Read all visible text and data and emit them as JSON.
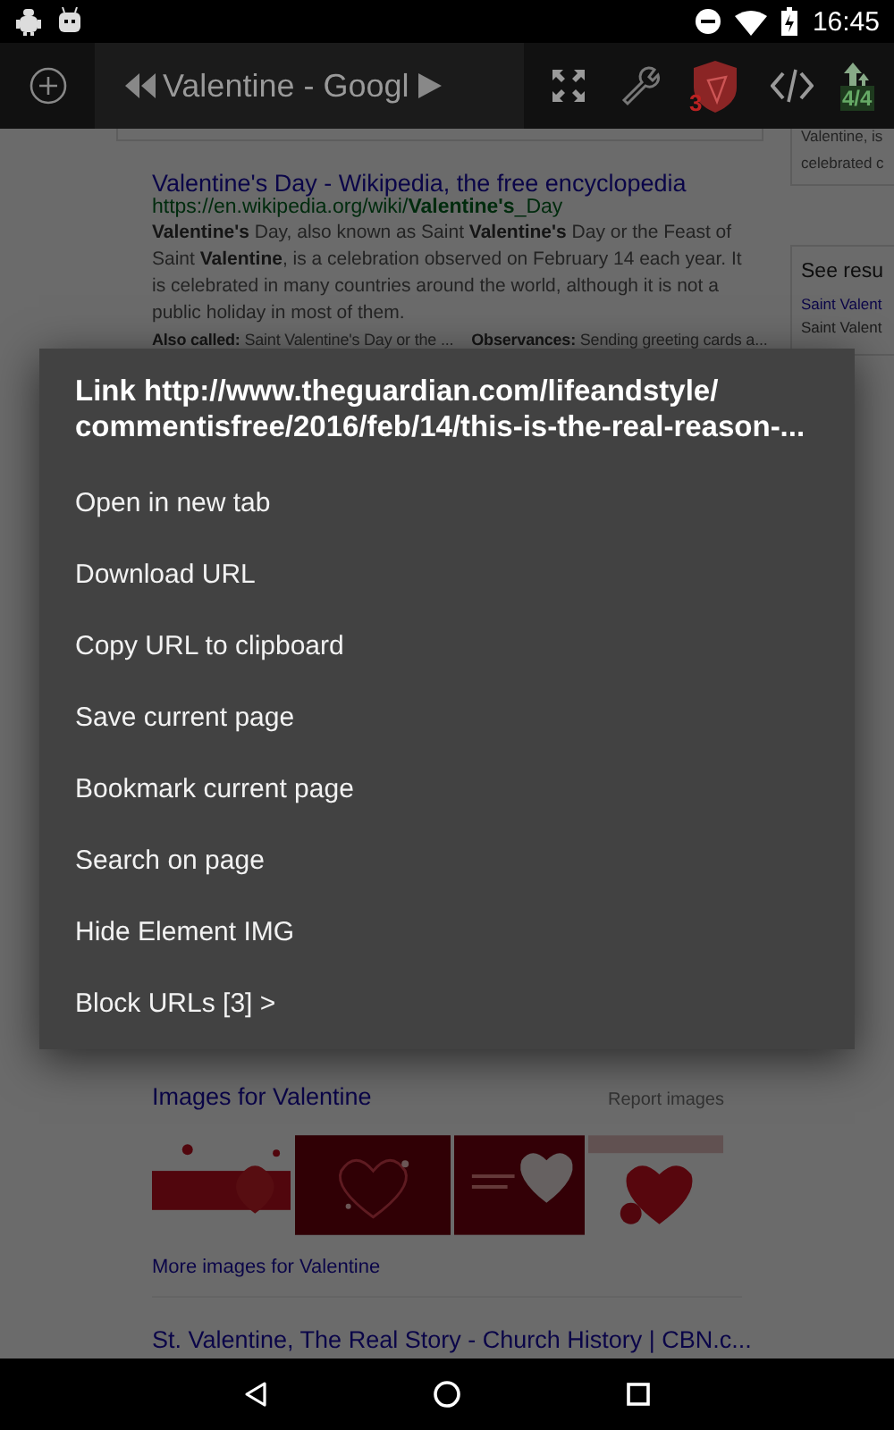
{
  "status_bar": {
    "time": "16:45"
  },
  "toolbar": {
    "title": "Valentine - Googl",
    "shield_count": "3",
    "tab_count": "4/4"
  },
  "page": {
    "side_top": [
      "Valentine, is",
      "celebrated c"
    ],
    "result": {
      "title": "Valentine's Day - Wikipedia, the free encyclopedia",
      "url": "https://en.wikipedia.org/wiki/**Valentine's**_Day",
      "snippet": "**Valentine's** Day, also known as Saint **Valentine's** Day or the Feast of Saint **Valentine**, is a celebration observed on February 14 each year. It is celebrated in many countries around the world, although it is not a public holiday in most of them.",
      "facts": [
        {
          "label": "Also called:",
          "value": "Saint Valentine's Day or the ..."
        },
        {
          "label": "Observances:",
          "value": "Sending greeting cards a..."
        }
      ]
    },
    "see_results": {
      "heading": "See resu",
      "items": [
        "Saint Valent",
        "Saint Valent"
      ]
    },
    "images": {
      "heading": "Images for Valentine",
      "report": "Report images",
      "more": "More images for Valentine"
    },
    "next_result": {
      "title": "St. Valentine, The Real Story - Church History | CBN.c..."
    }
  },
  "menu": {
    "title": [
      "Link http://www.theguardian.com/lifeandstyle/",
      "commentisfree/2016/feb/14/this-is-the-real-reason-..."
    ],
    "items": [
      "Open in new tab",
      "Download URL",
      "Copy URL to clipboard",
      "Save current page",
      "Bookmark current page",
      "Search on page",
      "Hide Element IMG",
      "Block URLs [3] >"
    ]
  }
}
